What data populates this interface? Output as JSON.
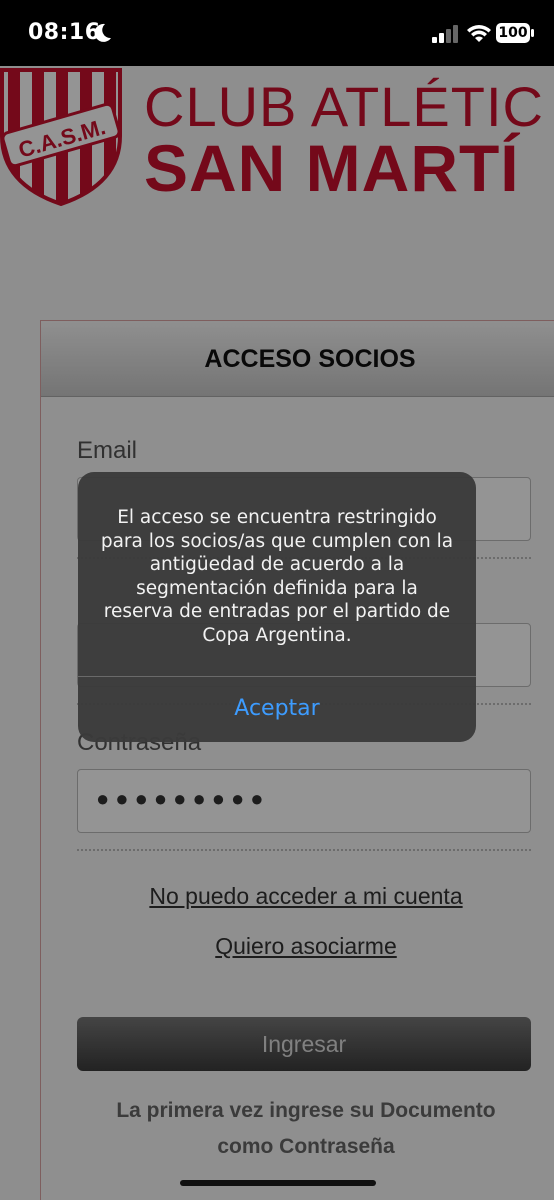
{
  "status_bar": {
    "time": "08:16",
    "battery": "100"
  },
  "brand": {
    "crest_text": "C.A.S.M.",
    "line1": "CLUB ATLÉTIC",
    "line2": "SAN MARTÍ"
  },
  "login": {
    "title": "ACCESO SOCIOS",
    "email_label": "Email",
    "password_label": "Contraseña",
    "password_value": "●●●●●●●●●",
    "forgot_link": "No puedo acceder a mi cuenta",
    "join_link": "Quiero asociarme",
    "submit_label": "Ingresar",
    "note_line1": "La primera vez ingrese su Documento",
    "note_line2": "como Contraseña"
  },
  "alert": {
    "message": "El acceso se encuentra restringido para los socios/as que cumplen con la antigüedad de acuerdo a la segmentación definida para la reserva de entradas por el partido de Copa Argentina.",
    "button": "Aceptar"
  },
  "colors": {
    "brand_red": "#c8102e",
    "alert_bg": "#3a3a3a",
    "alert_button": "#3d9cff"
  }
}
